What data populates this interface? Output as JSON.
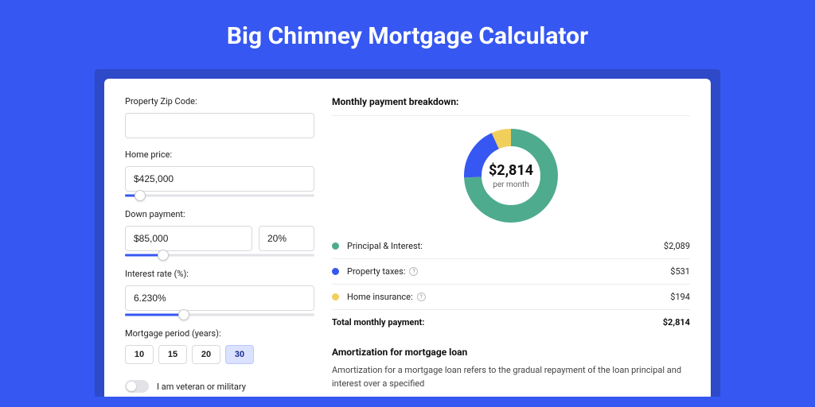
{
  "title": "Big Chimney Mortgage Calculator",
  "colors": {
    "green": "#4fab8e",
    "blue": "#3657f1",
    "yellow": "#f1cf5b"
  },
  "left": {
    "zip_label": "Property Zip Code:",
    "zip_value": "",
    "home_price_label": "Home price:",
    "home_price_value": "$425,000",
    "home_price_slider_pct": 8,
    "down_payment_label": "Down payment:",
    "down_payment_value": "$85,000",
    "down_payment_pct_value": "20%",
    "down_payment_slider_pct": 20,
    "interest_label": "Interest rate (%):",
    "interest_value": "6.230%",
    "interest_slider_pct": 31,
    "period_label": "Mortgage period (years):",
    "periods": [
      "10",
      "15",
      "20",
      "30"
    ],
    "period_active": "30",
    "veteran_label": "I am veteran or military"
  },
  "right": {
    "breakdown_heading": "Monthly payment breakdown:",
    "donut_center_amount": "$2,814",
    "donut_center_sub": "per month",
    "legend": [
      {
        "dot": "green",
        "label": "Principal & Interest:",
        "value": "$2,089",
        "help": false
      },
      {
        "dot": "blue",
        "label": "Property taxes:",
        "value": "$531",
        "help": true
      },
      {
        "dot": "yellow",
        "label": "Home insurance:",
        "value": "$194",
        "help": true
      }
    ],
    "total_label": "Total monthly payment:",
    "total_value": "$2,814",
    "amort_heading": "Amortization for mortgage loan",
    "amort_text": "Amortization for a mortgage loan refers to the gradual repayment of the loan principal and interest over a specified"
  },
  "chart_data": {
    "type": "pie",
    "title": "Monthly payment breakdown",
    "center_label": "$2,814 per month",
    "series": [
      {
        "name": "Principal & Interest",
        "value": 2089,
        "color": "#4fab8e"
      },
      {
        "name": "Property taxes",
        "value": 531,
        "color": "#3657f1"
      },
      {
        "name": "Home insurance",
        "value": 194,
        "color": "#f1cf5b"
      }
    ],
    "total": 2814
  }
}
